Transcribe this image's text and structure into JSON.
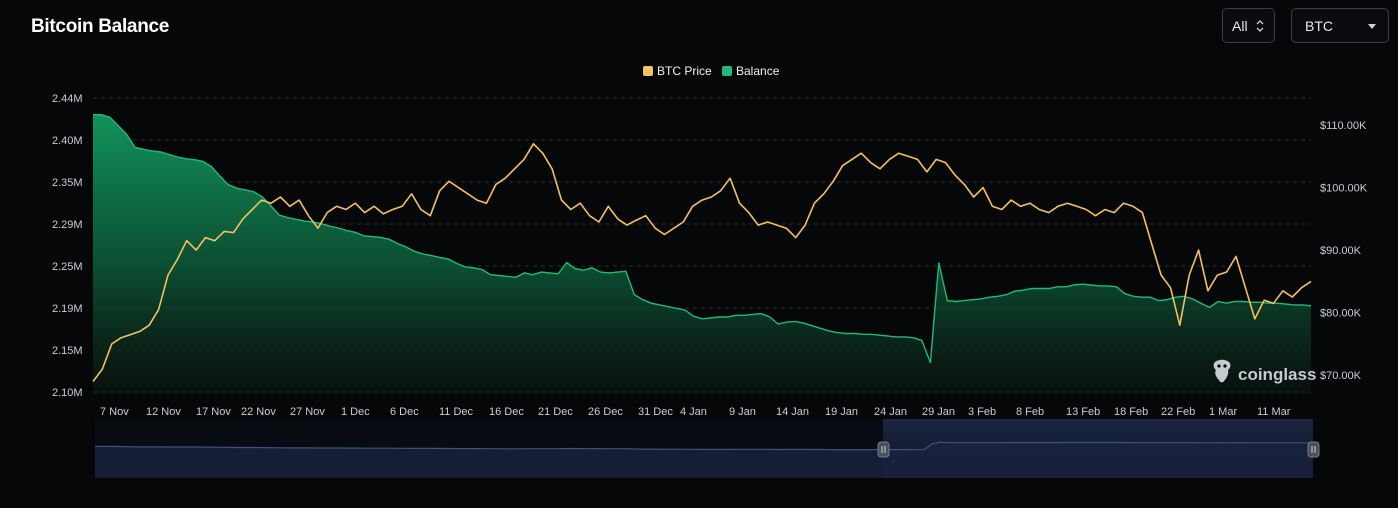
{
  "header": {
    "title": "Bitcoin Balance"
  },
  "controls": {
    "range_label": "All",
    "coin_label": "BTC"
  },
  "watermark": {
    "text": "coinglass"
  },
  "colors": {
    "btc_price": "#f4c15d",
    "balance": "#23b87a",
    "navigator": "#3b5283",
    "background": "#060709"
  },
  "chart_data": {
    "type": "area",
    "x_start": "5 Nov",
    "x_end": "17 Mar",
    "x_ticks": [
      "7 Nov",
      "12 Nov",
      "17 Nov",
      "22 Nov",
      "27 Nov",
      "1 Dec",
      "6 Dec",
      "11 Dec",
      "16 Dec",
      "21 Dec",
      "26 Dec",
      "31 Dec",
      "4 Jan",
      "9 Jan",
      "14 Jan",
      "19 Jan",
      "24 Jan",
      "29 Jan",
      "3 Feb",
      "8 Feb",
      "13 Feb",
      "18 Feb",
      "22 Feb",
      "1 Mar",
      "11 Mar"
    ],
    "y_left_ticks": [
      "2.10M",
      "2.15M",
      "2.19M",
      "2.25M",
      "2.29M",
      "2.35M",
      "2.40M",
      "2.44M"
    ],
    "y_left_range": [
      2100000,
      2440000
    ],
    "y_right_ticks": [
      "$70.00K",
      "$80.00K",
      "$90.00K",
      "$100.00K",
      "$110.00K"
    ],
    "y_right_range": [
      67000,
      114000
    ],
    "legend": [
      "BTC Price",
      "Balance"
    ],
    "legend_position": "top-center",
    "grid": true,
    "series": [
      {
        "name": "BTC Price",
        "axis": "right",
        "values": [
          [
            0,
            69000
          ],
          [
            1,
            71000
          ],
          [
            2,
            75000
          ],
          [
            3,
            76000
          ],
          [
            4,
            76500
          ],
          [
            5,
            77000
          ],
          [
            6,
            78000
          ],
          [
            7,
            80500
          ],
          [
            8,
            86000
          ],
          [
            9,
            88500
          ],
          [
            10,
            91500
          ],
          [
            11,
            90000
          ],
          [
            12,
            92000
          ],
          [
            13,
            91500
          ],
          [
            14,
            93000
          ],
          [
            15,
            92800
          ],
          [
            16,
            95000
          ],
          [
            17,
            96500
          ],
          [
            18,
            98000
          ],
          [
            19,
            97500
          ],
          [
            20,
            98500
          ],
          [
            21,
            97000
          ],
          [
            22,
            98000
          ],
          [
            23,
            95500
          ],
          [
            24,
            93500
          ],
          [
            25,
            96000
          ],
          [
            26,
            97000
          ],
          [
            27,
            96500
          ],
          [
            28,
            97500
          ],
          [
            29,
            96000
          ],
          [
            30,
            97000
          ],
          [
            31,
            95800
          ],
          [
            32,
            96500
          ],
          [
            33,
            97000
          ],
          [
            34,
            99000
          ],
          [
            35,
            96500
          ],
          [
            36,
            95500
          ],
          [
            37,
            99500
          ],
          [
            38,
            101000
          ],
          [
            39,
            100000
          ],
          [
            40,
            99000
          ],
          [
            41,
            98000
          ],
          [
            42,
            97500
          ],
          [
            43,
            100500
          ],
          [
            44,
            101500
          ],
          [
            45,
            103000
          ],
          [
            46,
            104500
          ],
          [
            47,
            107000
          ],
          [
            48,
            105500
          ],
          [
            49,
            103000
          ],
          [
            50,
            98000
          ],
          [
            51,
            96500
          ],
          [
            52,
            97500
          ],
          [
            53,
            95500
          ],
          [
            54,
            94500
          ],
          [
            55,
            97000
          ],
          [
            56,
            95000
          ],
          [
            57,
            94000
          ],
          [
            58,
            94800
          ],
          [
            59,
            95500
          ],
          [
            60,
            93500
          ],
          [
            61,
            92500
          ],
          [
            62,
            93500
          ],
          [
            63,
            94500
          ],
          [
            64,
            97000
          ],
          [
            65,
            98000
          ],
          [
            66,
            98500
          ],
          [
            67,
            99500
          ],
          [
            68,
            101500
          ],
          [
            69,
            97500
          ],
          [
            70,
            96000
          ],
          [
            71,
            94000
          ],
          [
            72,
            94500
          ],
          [
            73,
            94000
          ],
          [
            74,
            93500
          ],
          [
            75,
            92000
          ],
          [
            76,
            94000
          ],
          [
            77,
            97500
          ],
          [
            78,
            99000
          ],
          [
            79,
            101000
          ],
          [
            80,
            103500
          ],
          [
            81,
            104500
          ],
          [
            82,
            105500
          ],
          [
            83,
            104000
          ],
          [
            84,
            103000
          ],
          [
            85,
            104500
          ],
          [
            86,
            105500
          ],
          [
            87,
            105000
          ],
          [
            88,
            104500
          ],
          [
            89,
            102500
          ],
          [
            90,
            104500
          ],
          [
            91,
            104000
          ],
          [
            92,
            102000
          ],
          [
            93,
            100500
          ],
          [
            94,
            98500
          ],
          [
            95,
            100000
          ],
          [
            96,
            97000
          ],
          [
            97,
            96500
          ],
          [
            98,
            98000
          ],
          [
            99,
            97000
          ],
          [
            100,
            97500
          ],
          [
            101,
            96500
          ],
          [
            102,
            96000
          ],
          [
            103,
            97000
          ],
          [
            104,
            97500
          ],
          [
            105,
            97000
          ],
          [
            106,
            96500
          ],
          [
            107,
            95500
          ],
          [
            108,
            96500
          ],
          [
            109,
            96000
          ],
          [
            110,
            97500
          ],
          [
            111,
            97000
          ],
          [
            112,
            96000
          ],
          [
            113,
            91000
          ],
          [
            114,
            86000
          ],
          [
            115,
            84000
          ],
          [
            116,
            78000
          ],
          [
            117,
            86000
          ],
          [
            118,
            90000
          ],
          [
            119,
            83500
          ],
          [
            120,
            86000
          ],
          [
            121,
            86500
          ],
          [
            122,
            89000
          ],
          [
            123,
            84000
          ],
          [
            124,
            79000
          ],
          [
            125,
            82000
          ],
          [
            126,
            81500
          ],
          [
            127,
            83500
          ],
          [
            128,
            82500
          ],
          [
            129,
            84000
          ],
          [
            130,
            85000
          ]
        ]
      },
      {
        "name": "Balance",
        "axis": "left",
        "values": [
          [
            0,
            2423000
          ],
          [
            1,
            2423000
          ],
          [
            2,
            2420000
          ],
          [
            3,
            2410000
          ],
          [
            4,
            2400000
          ],
          [
            5,
            2385000
          ],
          [
            6,
            2383000
          ],
          [
            7,
            2381000
          ],
          [
            8,
            2380000
          ],
          [
            9,
            2377000
          ],
          [
            10,
            2374000
          ],
          [
            11,
            2372000
          ],
          [
            12,
            2371000
          ],
          [
            13,
            2369000
          ],
          [
            14,
            2363000
          ],
          [
            15,
            2352000
          ],
          [
            16,
            2342000
          ],
          [
            17,
            2338000
          ],
          [
            18,
            2336000
          ],
          [
            19,
            2334000
          ],
          [
            20,
            2328000
          ],
          [
            21,
            2318000
          ],
          [
            22,
            2307000
          ],
          [
            23,
            2304000
          ],
          [
            24,
            2302000
          ],
          [
            25,
            2300000
          ],
          [
            26,
            2299000
          ],
          [
            27,
            2297000
          ],
          [
            28,
            2294000
          ],
          [
            29,
            2292000
          ],
          [
            30,
            2289000
          ],
          [
            31,
            2287000
          ],
          [
            32,
            2283000
          ],
          [
            33,
            2282000
          ],
          [
            34,
            2281000
          ],
          [
            35,
            2279000
          ],
          [
            36,
            2274000
          ],
          [
            37,
            2270000
          ],
          [
            38,
            2265000
          ],
          [
            39,
            2262000
          ],
          [
            40,
            2260000
          ],
          [
            41,
            2258000
          ],
          [
            42,
            2256000
          ],
          [
            43,
            2251000
          ],
          [
            44,
            2247000
          ],
          [
            45,
            2246000
          ],
          [
            46,
            2244000
          ],
          [
            47,
            2238000
          ],
          [
            48,
            2237000
          ],
          [
            49,
            2236000
          ],
          [
            50,
            2235000
          ],
          [
            51,
            2240000
          ],
          [
            52,
            2238000
          ],
          [
            53,
            2241000
          ],
          [
            54,
            2240000
          ],
          [
            55,
            2239000
          ],
          [
            56,
            2252000
          ],
          [
            57,
            2245000
          ],
          [
            58,
            2243000
          ],
          [
            59,
            2246000
          ],
          [
            60,
            2241000
          ],
          [
            61,
            2240000
          ],
          [
            62,
            2241000
          ],
          [
            63,
            2242000
          ],
          [
            64,
            2215000
          ],
          [
            65,
            2209000
          ],
          [
            66,
            2205000
          ],
          [
            67,
            2203000
          ],
          [
            68,
            2201000
          ],
          [
            69,
            2199000
          ],
          [
            70,
            2197000
          ],
          [
            71,
            2190000
          ],
          [
            72,
            2187000
          ],
          [
            73,
            2188000
          ],
          [
            74,
            2189000
          ],
          [
            75,
            2189000
          ],
          [
            76,
            2191000
          ],
          [
            77,
            2191000
          ],
          [
            78,
            2192000
          ],
          [
            79,
            2193000
          ],
          [
            80,
            2189000
          ],
          [
            81,
            2181000
          ],
          [
            82,
            2183000
          ],
          [
            83,
            2184000
          ],
          [
            84,
            2182000
          ],
          [
            85,
            2179000
          ],
          [
            86,
            2176000
          ],
          [
            87,
            2173000
          ],
          [
            88,
            2171000
          ],
          [
            89,
            2170000
          ],
          [
            90,
            2170000
          ],
          [
            91,
            2169000
          ],
          [
            92,
            2169000
          ],
          [
            93,
            2168000
          ],
          [
            94,
            2167000
          ],
          [
            95,
            2166000
          ],
          [
            96,
            2166000
          ],
          [
            97,
            2165000
          ],
          [
            98,
            2162000
          ],
          [
            99,
            2136000
          ],
          [
            100,
            2252000
          ],
          [
            101,
            2208000
          ],
          [
            102,
            2207000
          ],
          [
            103,
            2208000
          ],
          [
            104,
            2209000
          ],
          [
            105,
            2210000
          ],
          [
            106,
            2212000
          ],
          [
            107,
            2213000
          ],
          [
            108,
            2215000
          ],
          [
            109,
            2219000
          ],
          [
            110,
            2220000
          ],
          [
            111,
            2222000
          ],
          [
            112,
            2222000
          ],
          [
            113,
            2222000
          ],
          [
            114,
            2224000
          ],
          [
            115,
            2224000
          ],
          [
            116,
            2226000
          ],
          [
            117,
            2227000
          ],
          [
            118,
            2226000
          ],
          [
            119,
            2225000
          ],
          [
            120,
            2225000
          ],
          [
            121,
            2224000
          ],
          [
            122,
            2216000
          ],
          [
            123,
            2213000
          ],
          [
            124,
            2212000
          ],
          [
            125,
            2212000
          ],
          [
            126,
            2208000
          ],
          [
            127,
            2209000
          ],
          [
            128,
            2212000
          ],
          [
            129,
            2213000
          ],
          [
            130,
            2210000
          ],
          [
            131,
            2205000
          ],
          [
            132,
            2200000
          ],
          [
            133,
            2207000
          ],
          [
            134,
            2205000
          ],
          [
            135,
            2207000
          ],
          [
            136,
            2207000
          ],
          [
            137,
            2206000
          ],
          [
            138,
            2206000
          ],
          [
            139,
            2205000
          ],
          [
            140,
            2205000
          ],
          [
            141,
            2204000
          ],
          [
            142,
            2203000
          ],
          [
            143,
            2203000
          ],
          [
            144,
            2202000
          ]
        ]
      }
    ],
    "navigator": {
      "selected_range": "Jan – Mar"
    }
  }
}
